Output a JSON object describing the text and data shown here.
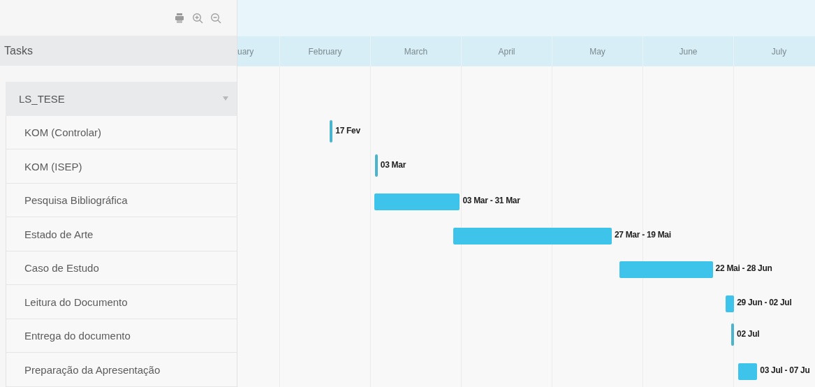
{
  "task_panel": {
    "heading": "Tasks",
    "group": {
      "name": "LS_TESE",
      "expanded": true,
      "children": [
        {
          "name": "KOM (Controlar)"
        },
        {
          "name": "KOM (ISEP)"
        },
        {
          "name": "Pesquisa Bibliográfica"
        },
        {
          "name": "Estado de Arte"
        },
        {
          "name": "Caso de Estudo"
        },
        {
          "name": "Leitura do Documento"
        },
        {
          "name": "Entrega do documento"
        },
        {
          "name": "Preparação da Apresentação"
        }
      ]
    }
  },
  "timeline": {
    "months": [
      "uary",
      "February",
      "March",
      "April",
      "May",
      "June",
      "July"
    ],
    "bars": [
      {
        "kind": "milestone",
        "label": "17 Fev"
      },
      {
        "kind": "milestone",
        "label": "03 Mar"
      },
      {
        "kind": "task",
        "label": "03 Mar - 31 Mar"
      },
      {
        "kind": "task",
        "label": "27 Mar - 19 Mai"
      },
      {
        "kind": "task",
        "label": "22 Mai - 28 Jun"
      },
      {
        "kind": "task",
        "label": "29 Jun - 02 Jul"
      },
      {
        "kind": "milestone",
        "label": "02 Jul"
      },
      {
        "kind": "task",
        "label": "03 Jul - 07 Ju"
      }
    ]
  }
}
